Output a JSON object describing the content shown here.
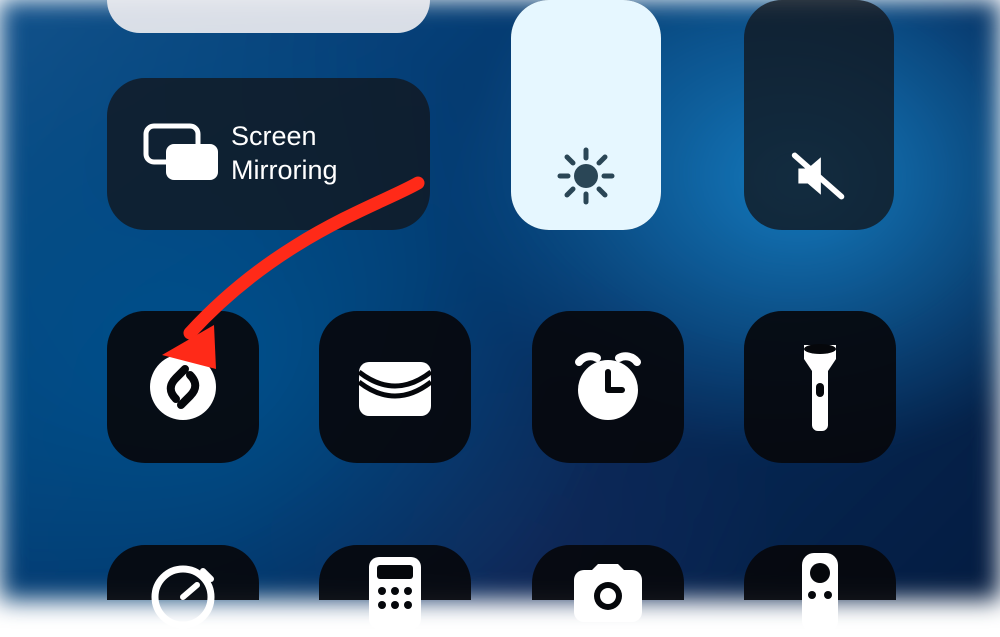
{
  "controls": {
    "screen_mirroring": {
      "label": "Screen\nMirroring"
    }
  },
  "sliders": {
    "brightness": {
      "fill_pct": 100
    },
    "volume": {
      "fill_pct": 0,
      "muted": true
    }
  },
  "tiles_row1": {
    "shazam": {
      "icon": "shazam-icon"
    },
    "wallet": {
      "icon": "wallet-icon"
    },
    "alarm": {
      "icon": "alarm-clock-icon"
    },
    "flashlight": {
      "icon": "flashlight-icon"
    }
  },
  "tiles_row2_partial": {
    "stopwatch": {
      "icon": "stopwatch-icon"
    },
    "calculator": {
      "icon": "calculator-icon"
    },
    "camera": {
      "icon": "camera-icon"
    },
    "remote": {
      "icon": "apple-tv-remote-icon"
    }
  },
  "annotation": {
    "color": "#ff2a18"
  }
}
